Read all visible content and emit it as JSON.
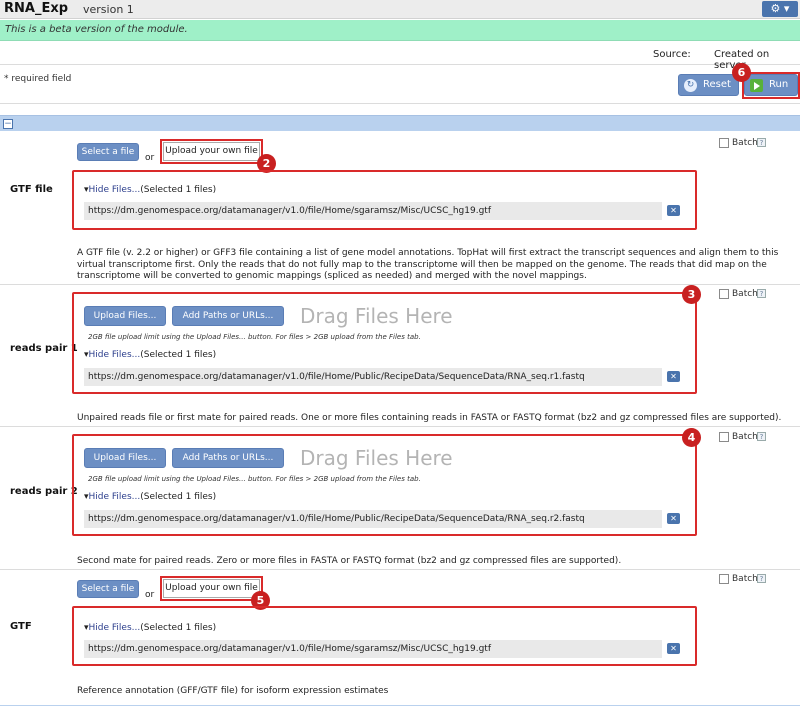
{
  "header": {
    "app_title": "RNA_Exp",
    "version": "version 1",
    "gear_label": "⚙ ▾"
  },
  "beta_message": "This is a beta version of the module.",
  "source": {
    "label": "Source:",
    "value": "Created on server"
  },
  "required_note": "* required field",
  "buttons": {
    "reset": "Reset",
    "run": "Run"
  },
  "section": {
    "collapse_icon": "−"
  },
  "common": {
    "or": "or",
    "select_file": "Select a file",
    "upload_own": "Upload your own file",
    "batch": "Batch",
    "help": "?",
    "hide_files": "Hide Files...",
    "selected": "(Selected 1 files)",
    "upload_files": "Upload Files...",
    "add_paths": "Add Paths or URLs...",
    "drag_files": "Drag Files Here",
    "upload_limit": "2GB file upload limit using the Upload Files... button. For files > 2GB upload from the Files tab.",
    "remove": "✕"
  },
  "params": [
    {
      "label": "GTF file",
      "url": "https://dm.genomespace.org/datamanager/v1.0/file/Home/sgaramsz/Misc/UCSC_hg19.gtf",
      "desc": [
        "A GTF file (v. 2.2 or higher) or GFF3 file containing a list of gene model annotations. TopHat will first extract the transcript sequences and align them to this",
        "virtual transcriptome first. Only the reads that do not fully map to the transcriptome will then be mapped on the genome. The reads that did map on the",
        "transcriptome will be converted to genomic mappings (spliced as needed) and merged with the novel mappings."
      ]
    },
    {
      "label": "reads pair 1",
      "url": "https://dm.genomespace.org/datamanager/v1.0/file/Home/Public/RecipeData/SequenceData/RNA_seq.r1.fastq",
      "desc": [
        "Unpaired reads file or first mate for paired reads. One or more files containing reads in FASTA or FASTQ format (bz2 and gz compressed files are supported)."
      ]
    },
    {
      "label": "reads pair 2",
      "url": "https://dm.genomespace.org/datamanager/v1.0/file/Home/Public/RecipeData/SequenceData/RNA_seq.r2.fastq",
      "desc": [
        "Second mate for paired reads. Zero or more files in FASTA or FASTQ format (bz2 and gz compressed files are supported)."
      ]
    },
    {
      "label": "GTF",
      "url": "https://dm.genomespace.org/datamanager/v1.0/file/Home/sgaramsz/Misc/UCSC_hg19.gtf",
      "desc": [
        "Reference annotation (GFF/GTF file) for isoform expression estimates"
      ]
    }
  ],
  "callouts": [
    "2",
    "3",
    "4",
    "5",
    "6"
  ]
}
